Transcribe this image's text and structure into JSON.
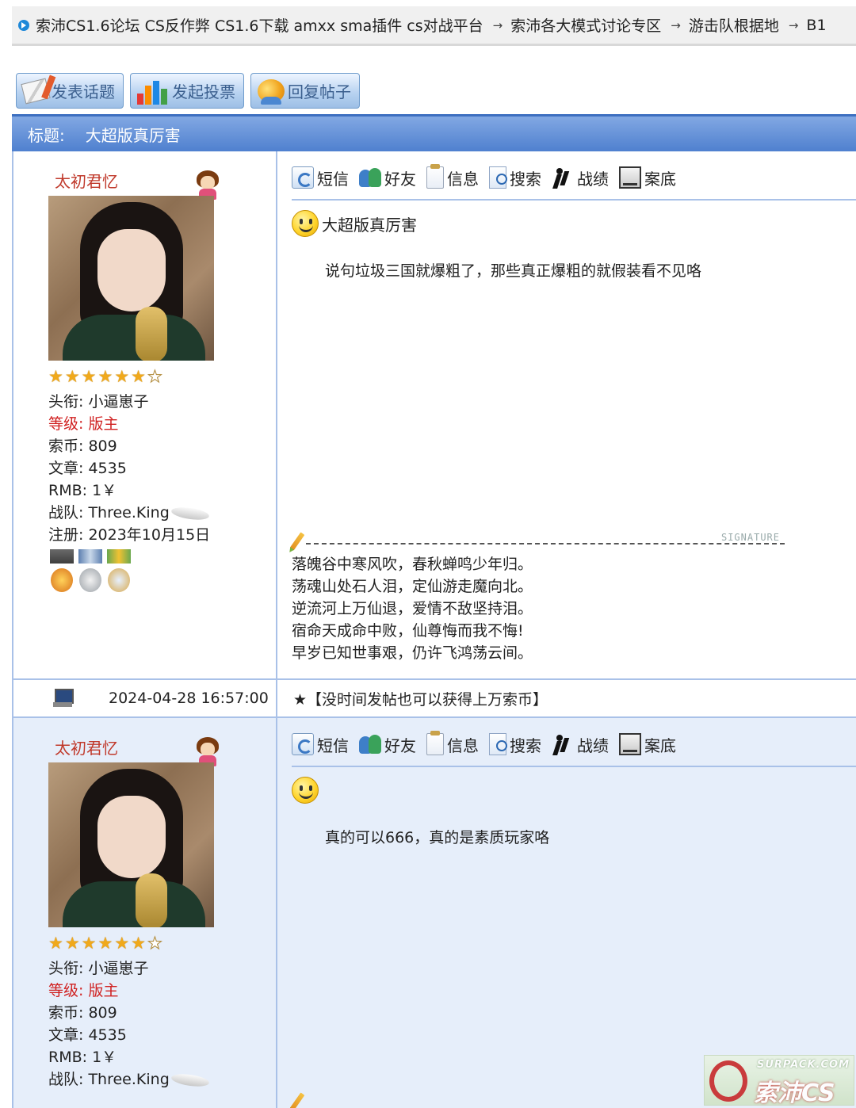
{
  "breadcrumb": {
    "items": [
      "索沛CS1.6论坛 CS反作弊 CS1.6下载 amxx sma插件 cs对战平台",
      "索沛各大模式讨论专区",
      "游击队根据地",
      "B1"
    ],
    "separator": "→"
  },
  "toolbar": {
    "new_topic": "发表话题",
    "new_poll": "发起投票",
    "reply": "回复帖子"
  },
  "thread": {
    "title_label": "标题:",
    "title": "大超版真厉害"
  },
  "actions": [
    "短信",
    "好友",
    "信息",
    "搜索",
    "战绩",
    "案底"
  ],
  "posts": [
    {
      "user": {
        "name": "太初君忆",
        "stars_filled": 6,
        "stars_total": 7,
        "title_label": "头衔:",
        "title": "小逼崽子",
        "level_label": "等级:",
        "level": "版主",
        "coins_label": "索币:",
        "coins": "809",
        "articles_label": "文章:",
        "articles": "4535",
        "rmb_label": "RMB:",
        "rmb": "1￥",
        "team_label": "战队:",
        "team": "Three.King",
        "registered_label": "注册:",
        "registered": "2023年10月15日"
      },
      "subject": "大超版真厉害",
      "body": "说句垃圾三国就爆粗了，那些真正爆粗的就假装看不见咯",
      "signature_label": "SIGNATURE",
      "signature": [
        "落魄谷中寒风吹，春秋蝉鸣少年归。",
        "荡魂山处石人泪，定仙游走魔向北。",
        "逆流河上万仙退，爱情不敌坚持泪。",
        "宿命天成命中败，仙尊悔而我不悔!",
        "早岁已知世事艰，仍许飞鸿荡云间。"
      ],
      "datetime": "2024-04-28 16:57:00",
      "promo": "★【没时间发帖也可以获得上万索币】"
    },
    {
      "user": {
        "name": "太初君忆",
        "stars_filled": 6,
        "stars_total": 7,
        "title_label": "头衔:",
        "title": "小逼崽子",
        "level_label": "等级:",
        "level": "版主",
        "coins_label": "索币:",
        "coins": "809",
        "articles_label": "文章:",
        "articles": "4535",
        "rmb_label": "RMB:",
        "rmb": "1￥",
        "team_label": "战队:",
        "team": "Three.King"
      },
      "subject": "",
      "body": "真的可以666，真的是素质玩家咯"
    }
  ],
  "watermark": {
    "top": "SURPACK.COM"
  },
  "colors": {
    "header_blue": "#4f80cf",
    "username_red": "#c0392b",
    "level_red": "#d02020",
    "border_blue": "#a9c1e8",
    "alt_row": "#e6eefa"
  }
}
